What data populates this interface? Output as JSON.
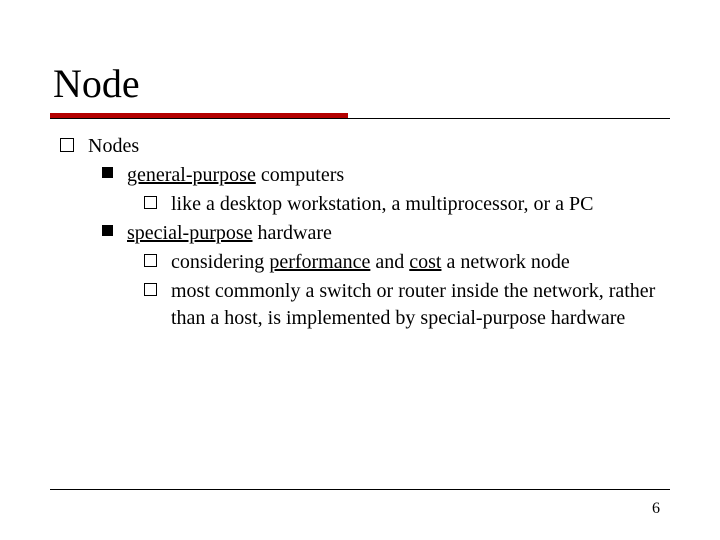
{
  "title": "Node",
  "bullets": {
    "l1_nodes": "Nodes",
    "l2_general": {
      "u": "general-purpose",
      "rest": " computers"
    },
    "l3_like_desktop": "like a desktop workstation, a multiprocessor, or a PC",
    "l2_special": {
      "u": "special-purpose",
      "rest": " hardware"
    },
    "l3_considering": {
      "pre": "considering ",
      "u1": "performance",
      "mid": " and ",
      "u2": "cost",
      "post": " a network node"
    },
    "l3_most_commonly": "most commonly a switch or router inside the network, rather than a host, is implemented by special-purpose hardware"
  },
  "page_number": "6"
}
